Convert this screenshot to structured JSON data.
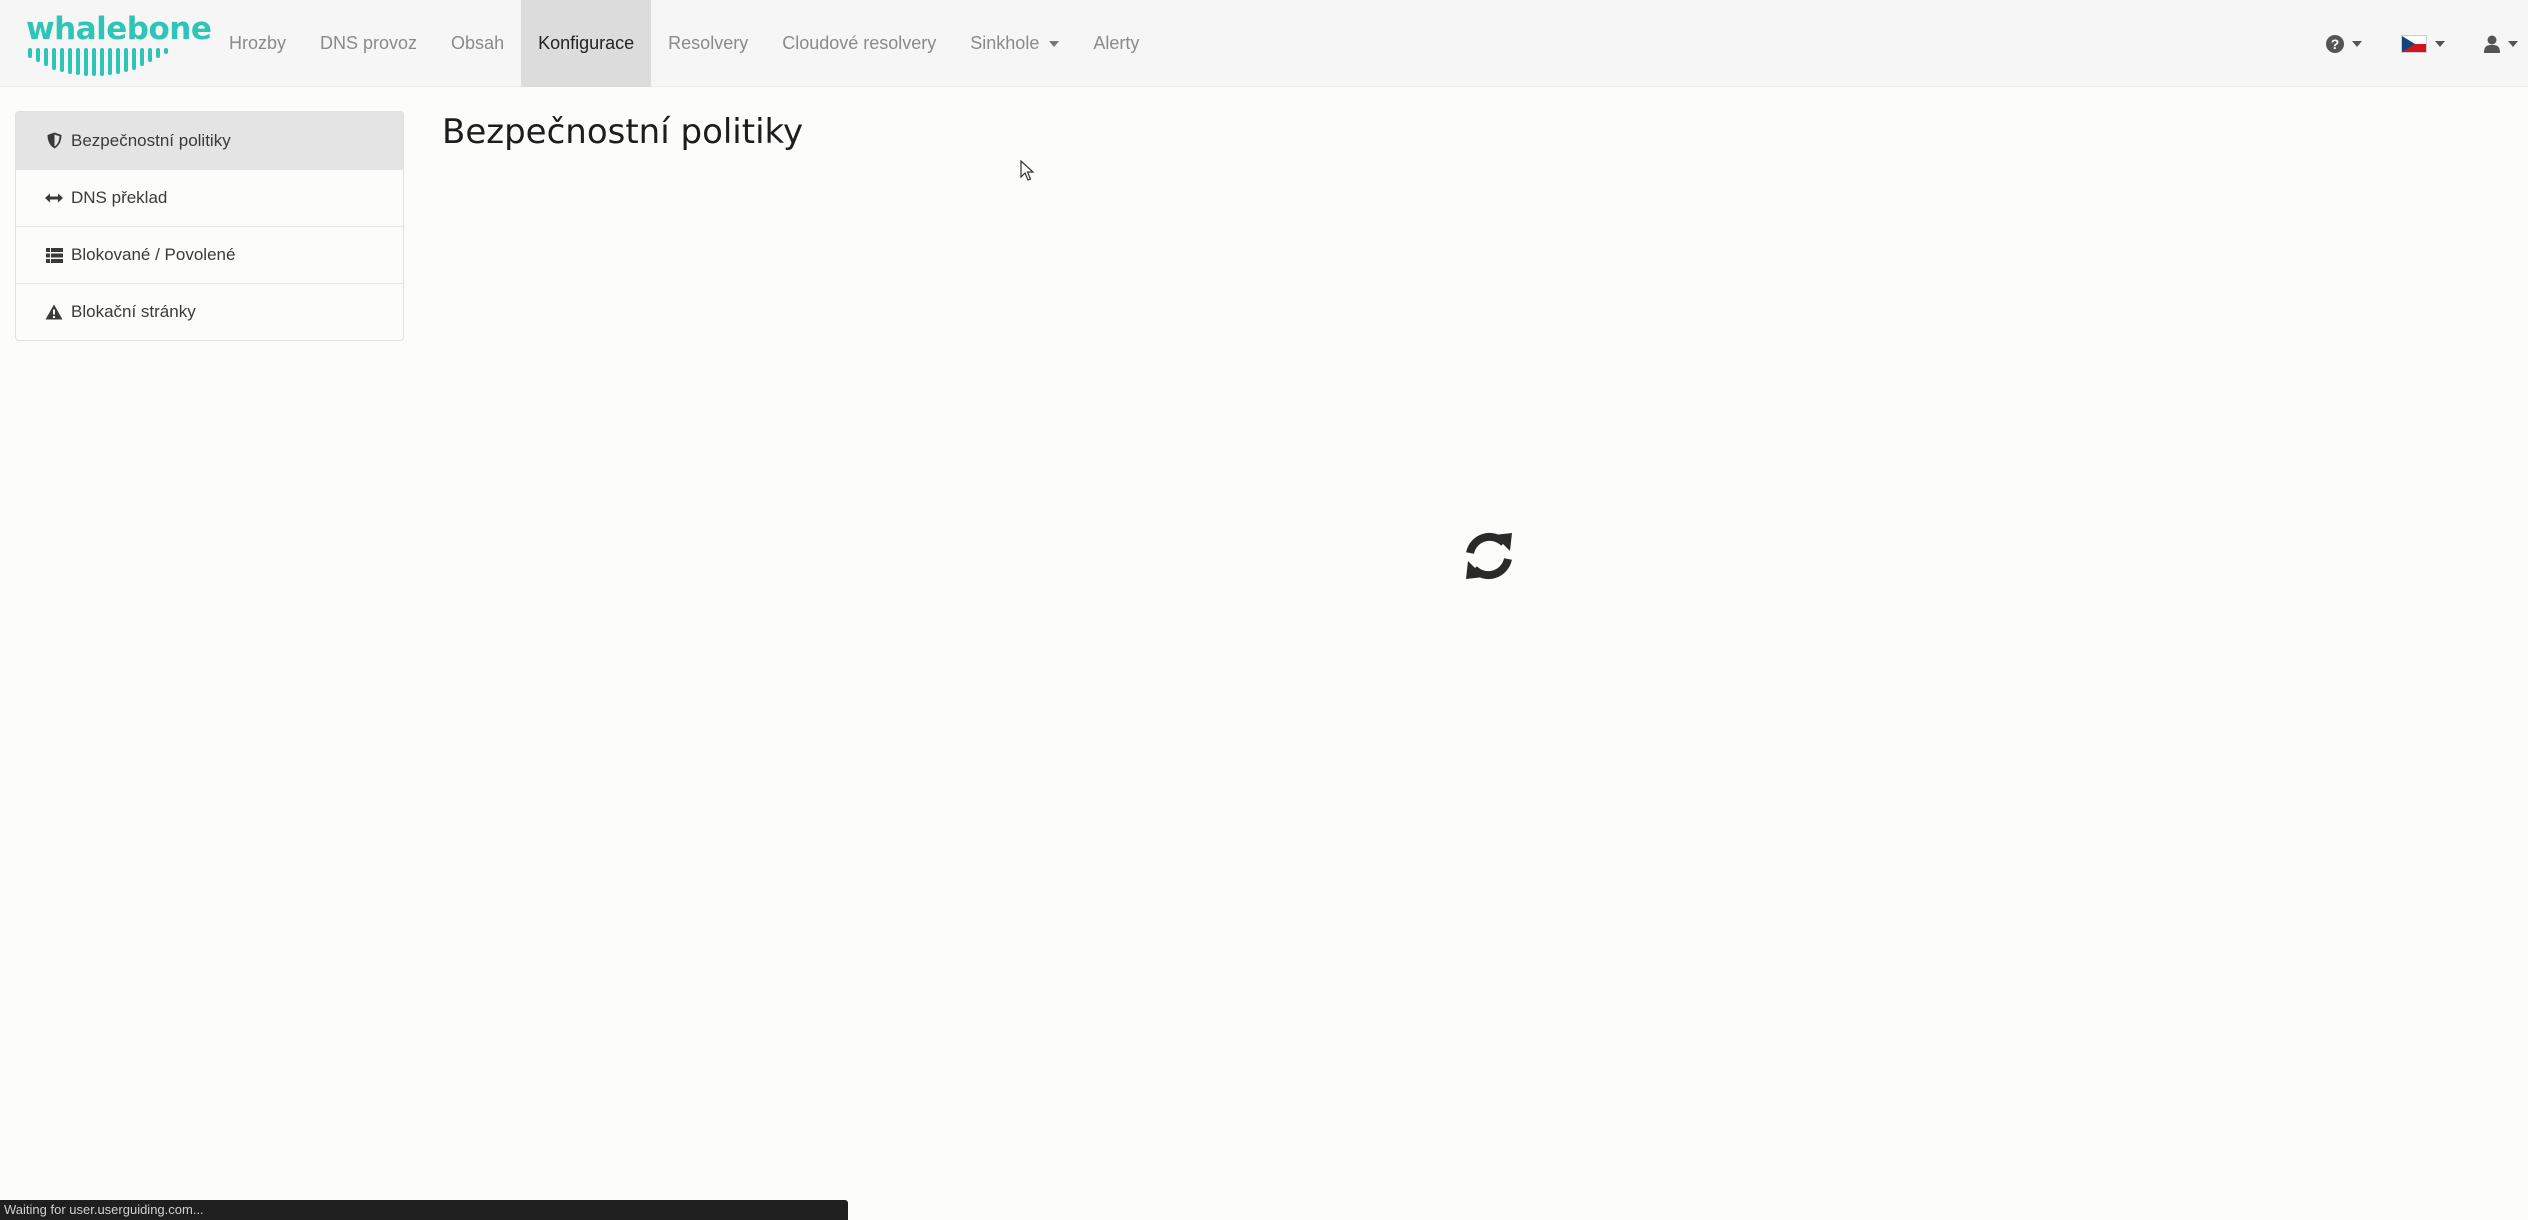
{
  "app": {
    "logo_text": "whalebone",
    "brand_color": "#2ec4b6"
  },
  "nav": {
    "items": [
      {
        "label": "Hrozby",
        "active": false,
        "dropdown": false
      },
      {
        "label": "DNS provoz",
        "active": false,
        "dropdown": false
      },
      {
        "label": "Obsah",
        "active": false,
        "dropdown": false
      },
      {
        "label": "Konfigurace",
        "active": true,
        "dropdown": false
      },
      {
        "label": "Resolvery",
        "active": false,
        "dropdown": false
      },
      {
        "label": "Cloudové resolvery",
        "active": false,
        "dropdown": false
      },
      {
        "label": "Sinkhole",
        "active": false,
        "dropdown": true
      },
      {
        "label": "Alerty",
        "active": false,
        "dropdown": false
      }
    ],
    "right": {
      "help_icon": "question-circle-icon",
      "language_icon": "czech-flag-icon",
      "user_icon": "user-icon"
    }
  },
  "sidebar": {
    "items": [
      {
        "label": "Bezpečnostní politiky",
        "icon": "shield-icon",
        "active": true
      },
      {
        "label": "DNS překlad",
        "icon": "arrows-horizontal-icon",
        "active": false
      },
      {
        "label": "Blokované / Povolené",
        "icon": "list-icon",
        "active": false
      },
      {
        "label": "Blokační stránky",
        "icon": "warning-icon",
        "active": false
      }
    ]
  },
  "main": {
    "title": "Bezpečnostní politiky",
    "loading_icon": "refresh-spinner-icon"
  },
  "status_bar": {
    "text": "Waiting for user.userguiding.com..."
  }
}
